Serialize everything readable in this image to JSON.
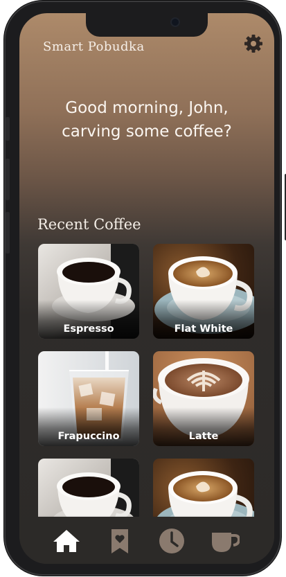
{
  "app": {
    "title": "Smart Pobudka"
  },
  "header": {
    "settings_icon": "gear-icon"
  },
  "greeting": {
    "line1": "Good morning, John,",
    "line2": "carving some coffee?"
  },
  "recent": {
    "title": "Recent Coffee",
    "items": [
      {
        "name": "Espresso",
        "image": "espresso-cup-photo"
      },
      {
        "name": "Flat White",
        "image": "flat-white-cup-photo"
      },
      {
        "name": "Frapuccino",
        "image": "iced-coffee-glass-photo"
      },
      {
        "name": "Latte",
        "image": "latte-art-cup-photo"
      },
      {
        "name": "",
        "image": "espresso-cup-photo"
      },
      {
        "name": "",
        "image": "flat-white-cup-photo"
      }
    ]
  },
  "nav": {
    "items": [
      {
        "icon": "home-icon",
        "active": true
      },
      {
        "icon": "bookmark-icon",
        "active": false
      },
      {
        "icon": "clock-icon",
        "active": false
      },
      {
        "icon": "coffee-cup-icon",
        "active": false
      }
    ]
  },
  "colors": {
    "accent": "#ad8a6a",
    "background_dark": "#2c2a28",
    "nav_inactive": "#8a7a6e",
    "nav_active": "#ffffff"
  }
}
